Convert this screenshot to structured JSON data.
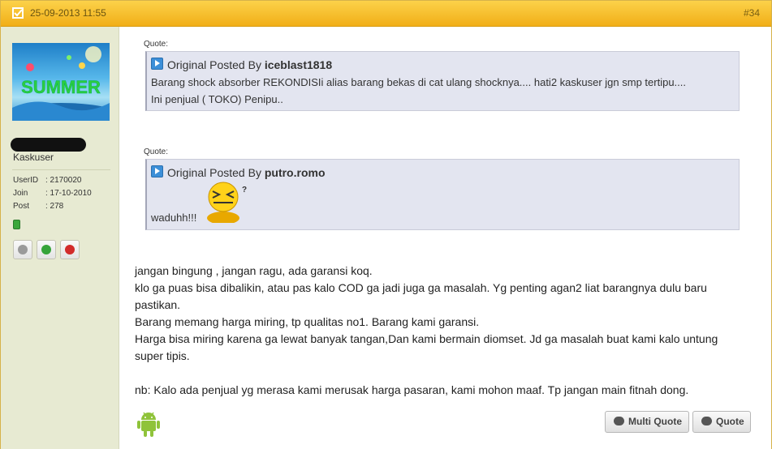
{
  "header": {
    "date": "25-09-2013 11:55",
    "post_number": "#34"
  },
  "user": {
    "rank": "Kaskuser",
    "userid_label": "UserID",
    "userid_value": ": 2170020",
    "join_label": "Join",
    "join_value": ": 17-10-2010",
    "post_label": "Post",
    "post_value": ": 278",
    "avatar_text": "SUMMER"
  },
  "quotes": [
    {
      "label": "Quote:",
      "prefix": "Original Posted By",
      "author": "iceblast1818",
      "lines": [
        "Barang shock absorber REKONDISIi alias barang bekas di cat ulang shocknya.... hati2 kaskuser jgn smp tertipu....",
        "Ini penjual ( TOKO) Penipu.."
      ]
    },
    {
      "label": "Quote:",
      "prefix": "Original Posted By",
      "author": "putro.romo",
      "lines": [
        "waduhh!!!"
      ]
    }
  ],
  "body": {
    "p1": "jangan bingung , jangan ragu, ada garansi koq.",
    "p2": "klo ga puas bisa dibalikin, atau pas kalo COD ga jadi juga ga masalah. Yg penting agan2 liat barangnya dulu baru pastikan.",
    "p3": "Barang memang harga miring, tp qualitas no1. Barang kami garansi.",
    "p4": "Harga bisa miring karena ga lewat banyak tangan,Dan kami bermain diomset. Jd ga masalah buat kami kalo untung super tipis.",
    "p5": "nb: Kalo ada penjual yg merasa kami merusak harga pasaran, kami mohon maaf. Tp jangan main fitnah dong."
  },
  "buttons": {
    "multi_quote": "Multi Quote",
    "quote": "Quote"
  },
  "colors": {
    "header": "#f1ae17",
    "sidebar": "#e7ead2",
    "quote_bg": "#e3e5f0",
    "android": "#8fc33a"
  }
}
